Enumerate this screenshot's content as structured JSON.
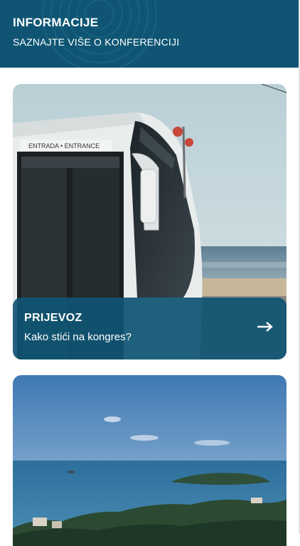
{
  "header": {
    "title": "INFORMACIJE",
    "subtitle": "SAZNAJTE VIŠE O KONFERENCIJI"
  },
  "cards": [
    {
      "title": "PRIJEVOZ",
      "subtitle": "Kako stići na kongres?",
      "image": "bus-by-the-sea-photo",
      "bus_sign": "ENTRADA • ENTRANCE",
      "action_icon": "arrow-right-icon"
    },
    {
      "image": "coastal-islands-photo"
    }
  ],
  "colors": {
    "brand": "#0f5573",
    "overlay": "#0f5573",
    "text": "#ffffff"
  }
}
